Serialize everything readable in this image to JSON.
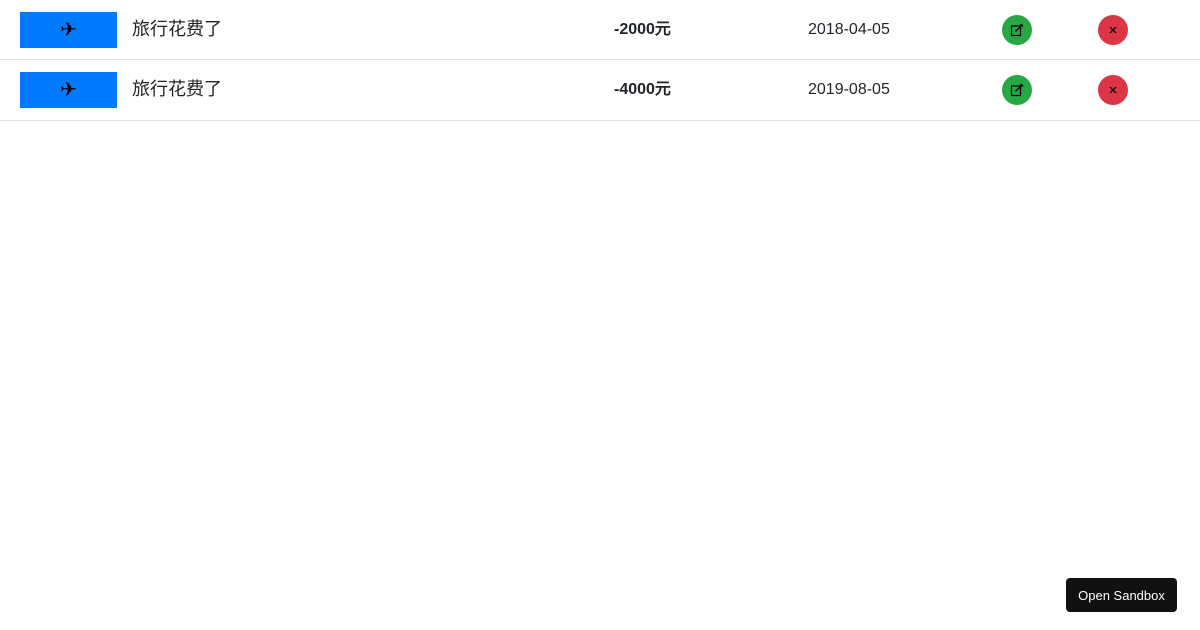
{
  "records": [
    {
      "category_icon": "airplane-icon",
      "title": "旅行花费了",
      "amount": "-2000元",
      "date": "2018-04-05",
      "edit_icon": "edit-icon",
      "delete_icon": "close-icon"
    },
    {
      "category_icon": "airplane-icon",
      "title": "旅行花费了",
      "amount": "-4000元",
      "date": "2019-08-05",
      "edit_icon": "edit-icon",
      "delete_icon": "close-icon"
    }
  ],
  "sandbox": {
    "label": "Open Sandbox"
  },
  "colors": {
    "primary": "#007bff",
    "success": "#28a745",
    "danger": "#dc3545",
    "sandbox_bg": "#111111"
  }
}
